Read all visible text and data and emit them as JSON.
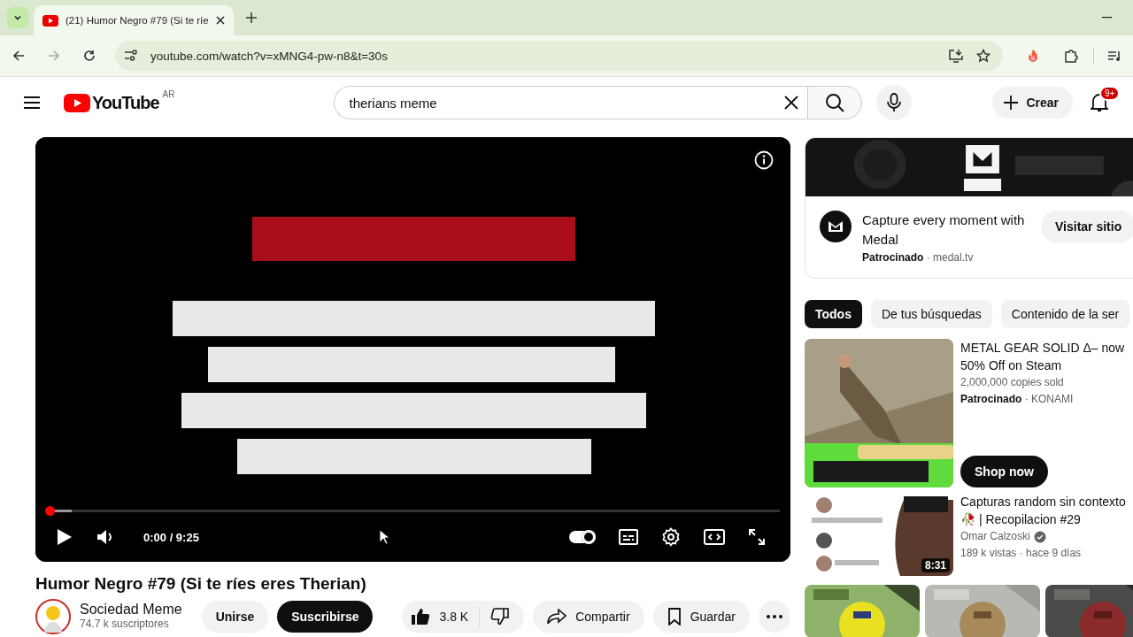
{
  "browser": {
    "tabs": [
      {
        "title": "(21) Humor Negro #79 (Si te ríe",
        "selected": true
      }
    ],
    "url": "youtube.com/watch?v=xMNG4-pw-n8&t=30s"
  },
  "header": {
    "brand": "YouTube",
    "country": "AR",
    "search": "therians meme",
    "create": "Crear",
    "notifications": "9+"
  },
  "player": {
    "time": "0:00 / 9:25",
    "level": 0.005,
    "autoplay": true
  },
  "video": {
    "title": "Humor Negro #79 (Si te ríes eres Therian)",
    "channel": "Sociedad Meme",
    "subscribers": "74.7 k suscriptores",
    "join": "Unirse",
    "subscribe": "Suscribirse",
    "likes": "3.8 K",
    "share": "Compartir",
    "save": "Guardar"
  },
  "ad": {
    "headline": "Capture every moment with Medal",
    "byline": "**Patrocinado** · medal.tv",
    "button": "Visitar sitio"
  },
  "chips": [
    {
      "label": "Todos",
      "selected": true
    },
    {
      "label": "De tus búsquedas",
      "selected": false
    },
    {
      "label": "Contenido de la ser",
      "selected": false
    }
  ],
  "recommendations": [
    {
      "kind": "ad",
      "title": "METAL GEAR SOLID Δ– now 50% Off on Steam",
      "subtitle": "2,000,000 copies sold",
      "byline": "**Patrocinado** · KONAMI",
      "button": "Shop now"
    },
    {
      "kind": "video",
      "title": "Capturas random sin contexto 🥀 | Recopilacion #29",
      "channel": "Omar Calzoski",
      "verified": true,
      "meta": "189 k vistas · hace 9 días",
      "duration": "8:31"
    }
  ]
}
